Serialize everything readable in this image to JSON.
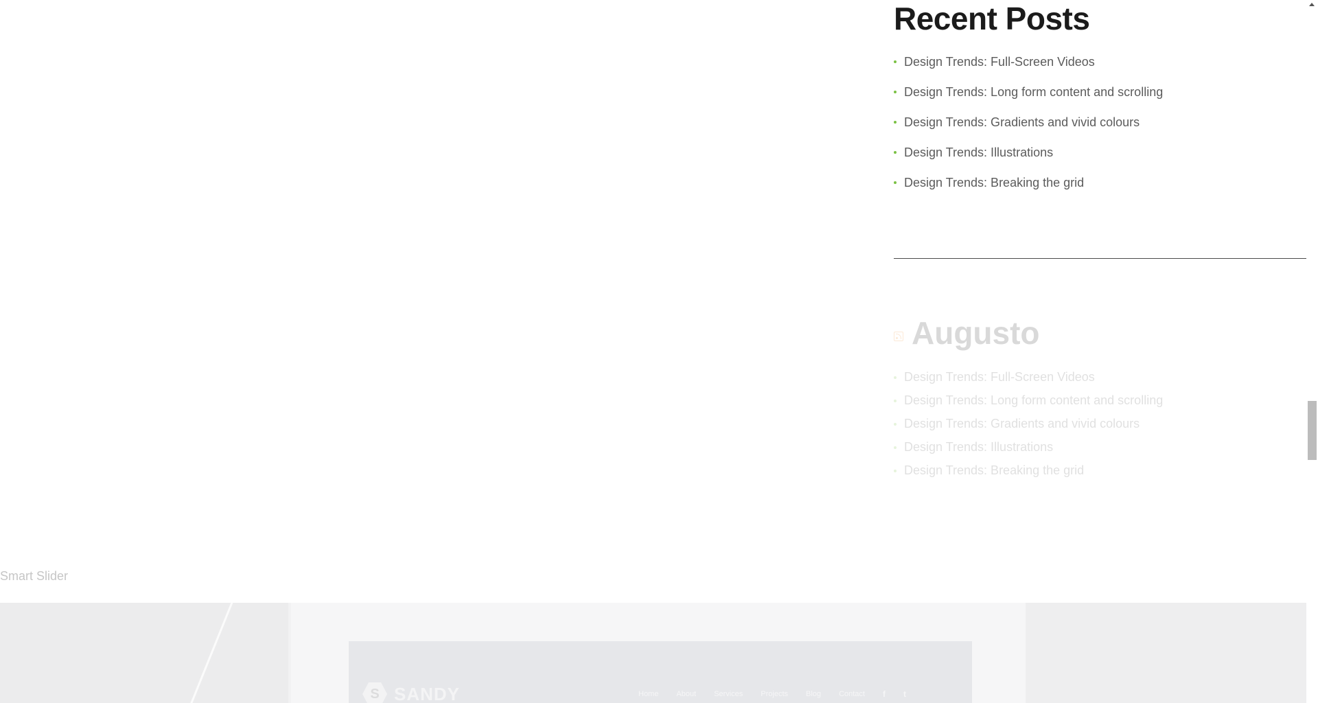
{
  "recent_posts": {
    "title": "Recent Posts",
    "items": [
      "Design Trends: Full-Screen Videos",
      "Design Trends: Long form content and scrolling",
      "Design Trends: Gradients and vivid colours",
      "Design Trends: Illustrations",
      "Design Trends: Breaking the grid"
    ]
  },
  "rss_widget": {
    "icon": "rss-icon",
    "title": "Augusto",
    "items": [
      "Design Trends: Full-Screen Videos",
      "Design Trends: Long form content and scrolling",
      "Design Trends: Gradients and vivid colours",
      "Design Trends: Illustrations",
      "Design Trends: Breaking the grid"
    ]
  },
  "slider": {
    "label": "Smart Slider"
  },
  "hero": {
    "logo_mark": "S",
    "logo_text": "SANDY",
    "nav": [
      "Home",
      "About",
      "Services",
      "Projects",
      "Blog",
      "Contact"
    ],
    "social": [
      "f",
      "t"
    ]
  },
  "colors": {
    "accent_bullet": "#7ac143",
    "heading": "#1b1b1b",
    "body_text": "#5b5b5b",
    "rss_orange": "#f08a24"
  }
}
